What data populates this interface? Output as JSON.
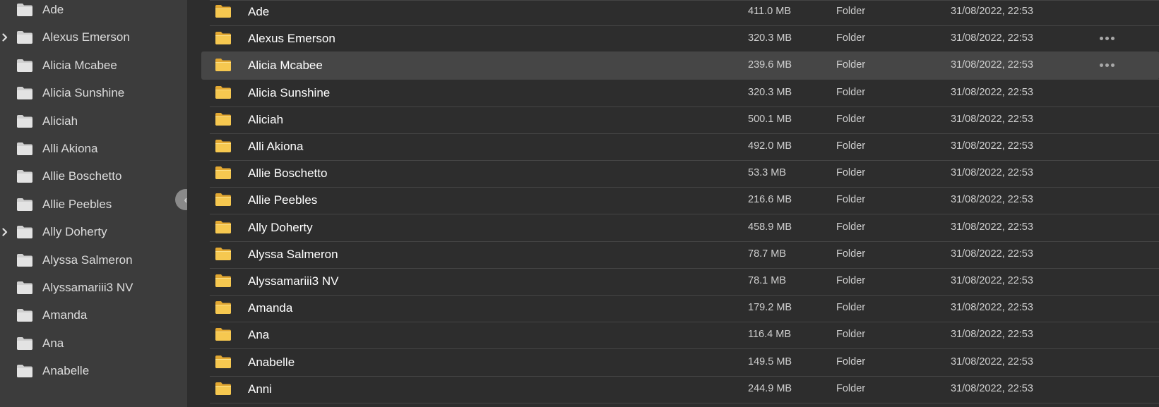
{
  "sidebar": {
    "items": [
      {
        "label": "Ade",
        "expandable": false
      },
      {
        "label": "Alexus Emerson",
        "expandable": true
      },
      {
        "label": "Alicia Mcabee",
        "expandable": false
      },
      {
        "label": "Alicia Sunshine",
        "expandable": false
      },
      {
        "label": "Aliciah",
        "expandable": false
      },
      {
        "label": "Alli Akiona",
        "expandable": false
      },
      {
        "label": "Allie Boschetto",
        "expandable": false
      },
      {
        "label": "Allie Peebles",
        "expandable": false
      },
      {
        "label": "Ally Doherty",
        "expandable": true
      },
      {
        "label": "Alyssa Salmeron",
        "expandable": false
      },
      {
        "label": "Alyssamariii3 NV",
        "expandable": false
      },
      {
        "label": "Amanda",
        "expandable": false
      },
      {
        "label": "Ana",
        "expandable": false
      },
      {
        "label": "Anabelle",
        "expandable": false
      }
    ],
    "collapse_glyph": "«"
  },
  "files": {
    "rows": [
      {
        "name": "Ade",
        "size": "411.0 MB",
        "kind": "Folder",
        "modified": "31/08/2022, 22:53",
        "more": false,
        "selected": false
      },
      {
        "name": "Alexus Emerson",
        "size": "320.3 MB",
        "kind": "Folder",
        "modified": "31/08/2022, 22:53",
        "more": true,
        "selected": false
      },
      {
        "name": "Alicia Mcabee",
        "size": "239.6 MB",
        "kind": "Folder",
        "modified": "31/08/2022, 22:53",
        "more": true,
        "selected": true
      },
      {
        "name": "Alicia Sunshine",
        "size": "320.3 MB",
        "kind": "Folder",
        "modified": "31/08/2022, 22:53",
        "more": false,
        "selected": false
      },
      {
        "name": "Aliciah",
        "size": "500.1 MB",
        "kind": "Folder",
        "modified": "31/08/2022, 22:53",
        "more": false,
        "selected": false
      },
      {
        "name": "Alli Akiona",
        "size": "492.0 MB",
        "kind": "Folder",
        "modified": "31/08/2022, 22:53",
        "more": false,
        "selected": false
      },
      {
        "name": "Allie Boschetto",
        "size": "53.3 MB",
        "kind": "Folder",
        "modified": "31/08/2022, 22:53",
        "more": false,
        "selected": false
      },
      {
        "name": "Allie Peebles",
        "size": "216.6 MB",
        "kind": "Folder",
        "modified": "31/08/2022, 22:53",
        "more": false,
        "selected": false
      },
      {
        "name": "Ally Doherty",
        "size": "458.9 MB",
        "kind": "Folder",
        "modified": "31/08/2022, 22:53",
        "more": false,
        "selected": false
      },
      {
        "name": "Alyssa Salmeron",
        "size": "78.7 MB",
        "kind": "Folder",
        "modified": "31/08/2022, 22:53",
        "more": false,
        "selected": false
      },
      {
        "name": "Alyssamariii3 NV",
        "size": "78.1 MB",
        "kind": "Folder",
        "modified": "31/08/2022, 22:53",
        "more": false,
        "selected": false
      },
      {
        "name": "Amanda",
        "size": "179.2 MB",
        "kind": "Folder",
        "modified": "31/08/2022, 22:53",
        "more": false,
        "selected": false
      },
      {
        "name": "Ana",
        "size": "116.4 MB",
        "kind": "Folder",
        "modified": "31/08/2022, 22:53",
        "more": false,
        "selected": false
      },
      {
        "name": "Anabelle",
        "size": "149.5 MB",
        "kind": "Folder",
        "modified": "31/08/2022, 22:53",
        "more": false,
        "selected": false
      },
      {
        "name": "Anni",
        "size": "244.9 MB",
        "kind": "Folder",
        "modified": "31/08/2022, 22:53",
        "more": false,
        "selected": false
      }
    ]
  },
  "icons": {
    "sidebar_folder": "folder-icon",
    "row_folder": "folder-icon",
    "expand": "chevron-right-icon",
    "more": "more-horizontal-icon",
    "collapse": "collapse-sidebar-icon"
  },
  "colors": {
    "sidebar_bg": "#3c3c3c",
    "main_bg": "#2d2d2d",
    "selected_row": "#464646",
    "folder_yellow": "#f6c850",
    "folder_yellow_dark": "#e2a832",
    "sidebar_folder": "#d8d8d8"
  }
}
